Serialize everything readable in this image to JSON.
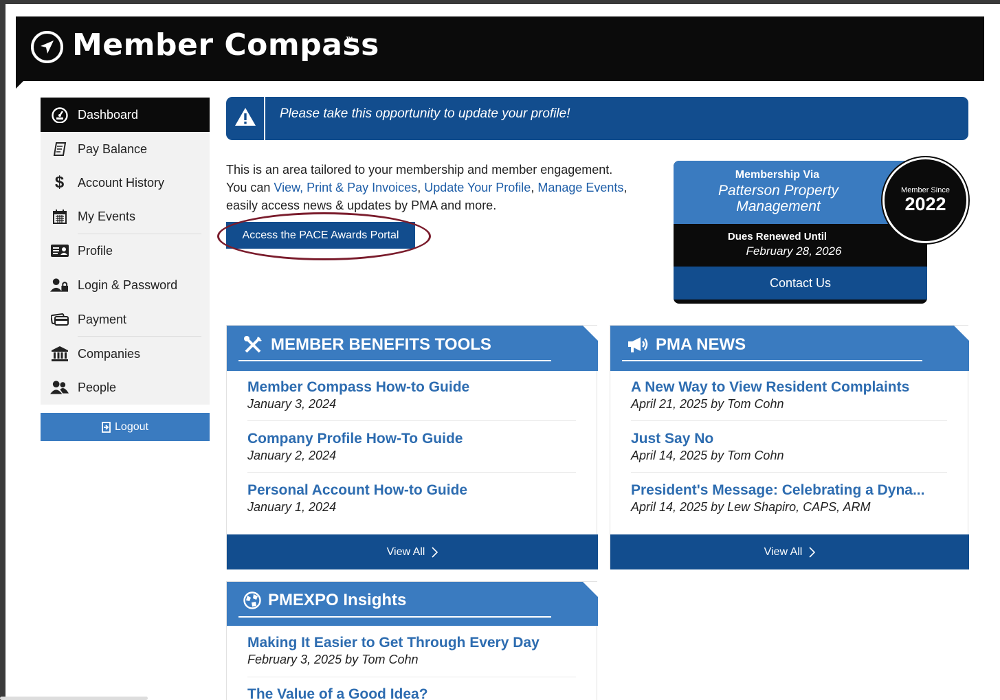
{
  "header": {
    "title": "Member Compass",
    "trademark": "™"
  },
  "sidebar": {
    "items": [
      {
        "label": "Dashboard",
        "icon": "dashboard-icon"
      },
      {
        "label": "Pay Balance",
        "icon": "receipt-icon"
      },
      {
        "label": "Account History",
        "icon": "dollar-icon"
      },
      {
        "label": "My Events",
        "icon": "calendar-icon"
      },
      {
        "label": "Profile",
        "icon": "id-card-icon"
      },
      {
        "label": "Login & Password",
        "icon": "user-lock-icon"
      },
      {
        "label": "Payment",
        "icon": "credit-card-icon"
      },
      {
        "label": "Companies",
        "icon": "bank-icon"
      },
      {
        "label": "People",
        "icon": "users-icon"
      }
    ],
    "logout_label": "Logout"
  },
  "alert": {
    "text": "Please take this opportunity to update your profile!"
  },
  "intro": {
    "line1": "This is an area tailored to your membership and member engagement.",
    "you_can": "You can ",
    "link1": "View, Print & Pay Invoices",
    "sep1": ", ",
    "link2": "Update Your Profile",
    "sep2": ", ",
    "link3": "Manage Events",
    "sep3": ",",
    "line3": "easily access news & updates by PMA and more.",
    "pace_button": "Access the PACE Awards Portal"
  },
  "membership": {
    "via_label": "Membership Via",
    "company": "Patterson Property Management",
    "dues_label": "Dues Renewed Until",
    "dues_date": "February 28, 2026",
    "contact_label": "Contact Us",
    "since_label": "Member Since",
    "since_year": "2022"
  },
  "benefits": {
    "title": "MEMBER BENEFITS TOOLS",
    "posts": [
      {
        "title": "Member Compass How-to Guide",
        "date": "January 3, 2024"
      },
      {
        "title": "Company Profile How-To Guide",
        "date": "January 2, 2024"
      },
      {
        "title": "Personal Account How-to Guide",
        "date": "January 1, 2024"
      }
    ],
    "view_all": "View All"
  },
  "news": {
    "title": "PMA NEWS",
    "posts": [
      {
        "title": "A New Way to View Resident Complaints",
        "date": "April 21, 2025 by Tom Cohn"
      },
      {
        "title": "Just Say No",
        "date": "April 14, 2025 by Tom Cohn"
      },
      {
        "title": "President's Message: Celebrating a Dyna...",
        "date": "April 14, 2025 by Lew Shapiro, CAPS, ARM"
      }
    ],
    "view_all": "View All"
  },
  "insights": {
    "title": "PMEXPO Insights",
    "posts": [
      {
        "title": "Making It Easier to Get Through Every Day",
        "date": "February 3, 2025 by Tom Cohn"
      },
      {
        "title": "The Value of a Good Idea?",
        "date": ""
      }
    ]
  }
}
